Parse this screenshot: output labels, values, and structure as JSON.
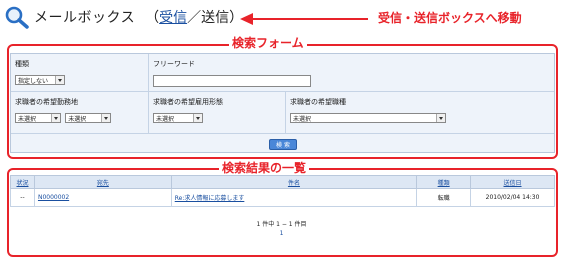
{
  "header": {
    "title": "メールボックス",
    "paren_open": "（",
    "inbox_link": "受信",
    "separator": "／送信",
    "paren_close": "）"
  },
  "annotations": {
    "arrow_caption": "受信・送信ボックスへ移動",
    "search_form": "検索フォーム",
    "search_results": "検索結果の一覧"
  },
  "form": {
    "type_label": "種類",
    "type_value": "指定しない",
    "freeword_label": "フリーワード",
    "freeword_value": "",
    "location_label": "求職者の希望勤務地",
    "location_value1": "未選択",
    "location_value2": "未選択",
    "employment_label": "求職者の希望雇用形態",
    "employment_value": "未選択",
    "job_type_label": "求職者の希望職種",
    "job_type_value": "未選択",
    "search_button": "検 索"
  },
  "table": {
    "columns": [
      "状況",
      "宛先",
      "件名",
      "種類",
      "送信日"
    ],
    "rows": [
      [
        "--",
        "N0000002",
        "Re:求人情報に応募します",
        "転職",
        "2010/02/04 14:30"
      ]
    ]
  },
  "pagination": {
    "summary": "1 件中 1 − 1 件目",
    "page": "1"
  },
  "colors": {
    "annotation_red": "#e8232a",
    "link_blue": "#1a4fa0",
    "panel_bg": "#eef3fa",
    "header_bg": "#dde7f4",
    "button_blue": "#4a87d8"
  },
  "icons": {
    "title_icon": "search-icon",
    "arrow": "arrow-left-icon"
  }
}
